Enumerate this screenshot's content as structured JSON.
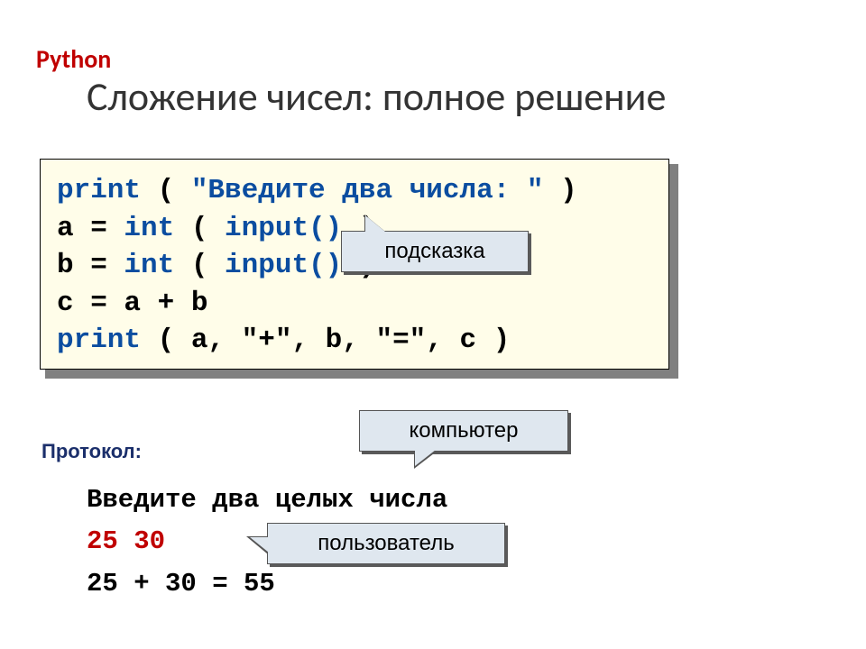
{
  "header": {
    "lang": "Python",
    "title": "Сложение чисел: полное решение"
  },
  "code": {
    "line1": {
      "fn": "print",
      "paren_l": " ( ",
      "str": "\"Введите два числа: \"",
      "paren_r": " )"
    },
    "line2": {
      "lhs": "a",
      "eq": " = ",
      "cast": "int",
      "paren_l": " ( ",
      "fn": "input()",
      "paren_r": " )"
    },
    "line3": {
      "lhs": "b",
      "eq": " = ",
      "cast": "int",
      "paren_l": " ( ",
      "fn": "input()",
      "paren_r": " )"
    },
    "line4": {
      "lhs": "c",
      "eq": " = ",
      "rhs": "a + b"
    },
    "line5": {
      "fn": "print",
      "paren_l": " ( ",
      "args": "a, \"+\", b, \"=\", c",
      "paren_r": " )"
    }
  },
  "callouts": {
    "hint": "подсказка",
    "computer": "компьютер",
    "user": "пользователь"
  },
  "protocol": {
    "label": "Протокол:",
    "line1": "Введите два целых числа",
    "line2": "25 30",
    "line3": "25 + 30 = 55"
  }
}
